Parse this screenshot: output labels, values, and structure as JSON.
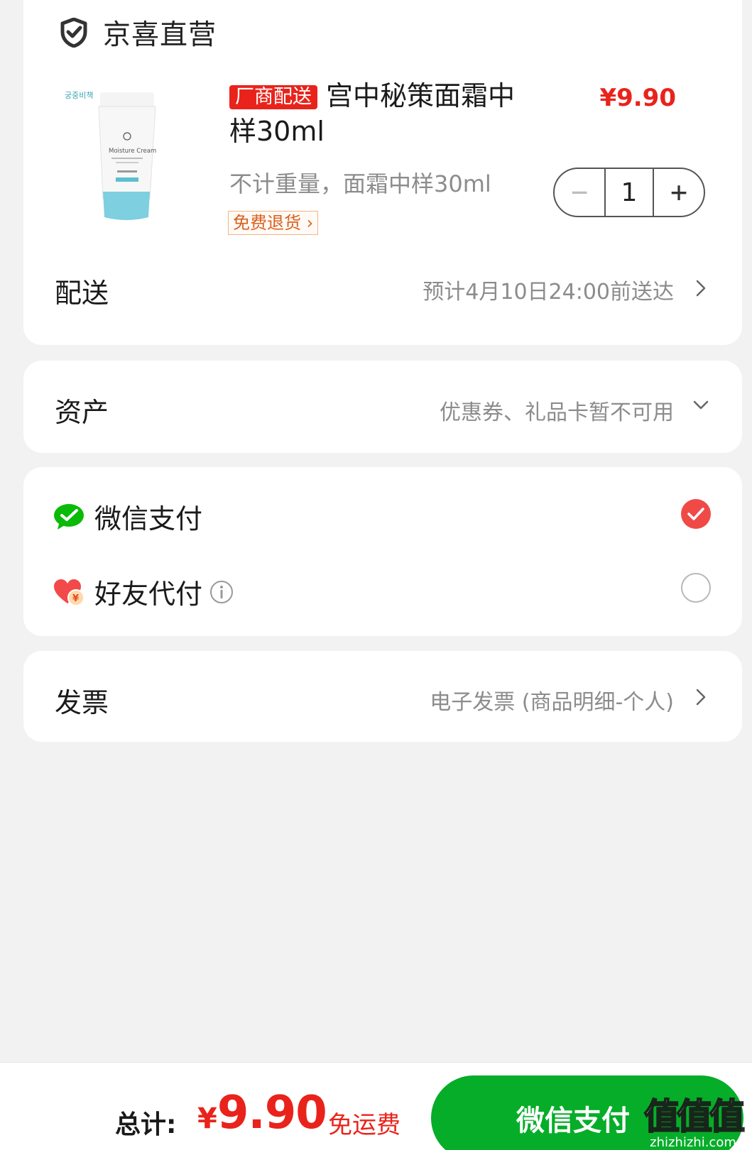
{
  "store": {
    "name": "京喜直营",
    "icon": "shield-check-icon"
  },
  "product": {
    "vendor_tag": "厂商配送",
    "title": "宫中秘策面霜中样30ml",
    "price": "¥9.90",
    "spec": "不计重量，面霜中样30ml",
    "return_tag": "免费退货",
    "quantity": "1",
    "image_text_brand": "궁중비책",
    "image_text_name": "Moisture Cream"
  },
  "delivery": {
    "label": "配送",
    "value": "预计4月10日24:00前送达"
  },
  "assets": {
    "label": "资产",
    "value": "优惠券、礼品卡暂不可用"
  },
  "payment": {
    "options": [
      {
        "label": "微信支付",
        "icon": "wechat-icon",
        "selected": true
      },
      {
        "label": "好友代付",
        "icon": "friend-pay-icon",
        "selected": false
      }
    ]
  },
  "invoice": {
    "label": "发票",
    "value": "电子发票 (商品明细-个人)"
  },
  "footer": {
    "total_label": "总计:",
    "currency": "¥",
    "total_amount": "9.90",
    "shipping": "免运费",
    "pay_button": "微信支付",
    "watermark": "值值值",
    "watermark_url": "zhizhizhi.com"
  },
  "colors": {
    "accent_red": "#e9231b",
    "wechat_green": "#06ad28",
    "background": "#f2f2f2"
  }
}
